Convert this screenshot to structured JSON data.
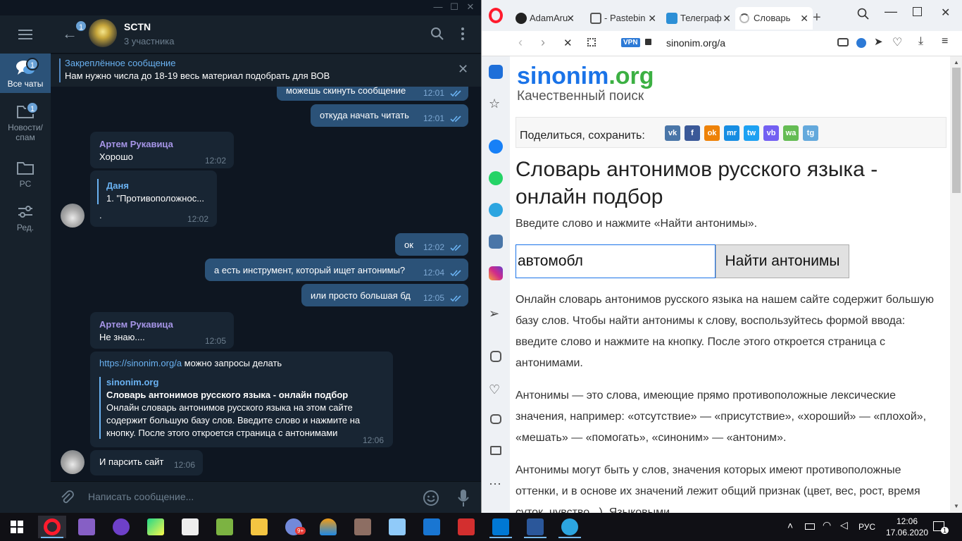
{
  "telegram": {
    "folders": [
      {
        "label": "Все чаты",
        "badge": "1"
      },
      {
        "label": "Новости/\nспам",
        "badge": "1"
      },
      {
        "label": "PC",
        "badge": ""
      },
      {
        "label": "Ред.",
        "badge": ""
      }
    ],
    "header": {
      "back_badge": "1",
      "title": "SCTN",
      "subtitle": "3 участника"
    },
    "pinned": {
      "title": "Закреплённое сообщение",
      "text": "Нам нужно числа до 18-19 весь материал подобрать для ВОВ"
    },
    "messages": [
      {
        "text": "можешь скинуть сообщение",
        "time": "12:01"
      },
      {
        "text": "откуда начать читать",
        "time": "12:01"
      },
      {
        "sender": "Артем Рукавица",
        "text": "Хорошо",
        "time": "12:02"
      },
      {
        "reply_name": "Даня",
        "reply_text": "1. \"Противоположнос...",
        "text": ".",
        "time": "12:02"
      },
      {
        "text": "ок",
        "time": "12:02"
      },
      {
        "text": "а есть инструмент, который ищет антонимы?",
        "time": "12:04"
      },
      {
        "text": "или просто большая бд",
        "time": "12:05"
      },
      {
        "sender": "Артем Рукавица",
        "text": "Не знаю....",
        "time": "12:05"
      },
      {
        "link": "https://sinonim.org/a",
        "text_after": " можно запросы делать",
        "preview_site": "sinonim.org",
        "preview_title": "Словарь антонимов русского языка - онлайн подбор",
        "preview_desc": "Онлайн словарь антонимов русского языка на этом сайте содержит большую базу слов. Введите слово и нажмите на кнопку. После этого откроется страница с антонимами",
        "time": "12:06"
      },
      {
        "text": "И парсить сайт",
        "time": "12:06"
      }
    ],
    "compose_placeholder": "Написать сообщение..."
  },
  "opera": {
    "tabs": [
      {
        "label": "AdamAru"
      },
      {
        "label": "- Pastebin"
      },
      {
        "label": "Телеграф"
      },
      {
        "label": "Словарь"
      }
    ],
    "address": {
      "vpn": "VPN",
      "url": "sinonim.org/a"
    },
    "page": {
      "logo_main": "sinonim",
      "logo_tld": ".org",
      "tagline": "Качественный поиск",
      "share_label": "Поделиться, сохранить:",
      "share_icons": [
        "vk",
        "f",
        "ok",
        "mr",
        "tw",
        "vb",
        "wa",
        "tg"
      ],
      "heading": "Словарь антонимов русского языка - онлайн подбор",
      "instruction": "Введите слово и нажмите «Найти антонимы».",
      "search_value": "автомобл",
      "search_button": "Найти антонимы",
      "para1": "Онлайн словарь антонимов русского языка на нашем сайте содержит большую базу слов. Чтобы найти антонимы к слову, воспользуйтесь формой ввода: введите слово и нажмите на кнопку. После этого откроется страница с антонимами.",
      "para2": "Антонимы — это слова, имеющие прямо противоположные лексические значения, например: «отсутствие» — «присутствие», «хороший» — «плохой», «мешать» — «помогать», «синоним» — «антоним».",
      "para3": "Антонимы могут быть у слов, значения которых имеют противоположные оттенки, и в основе их значений лежит общий признак (цвет, вес, рост, время суток, чувство...). Языковыми"
    }
  },
  "taskbar": {
    "language": "РУС",
    "time": "12:06",
    "date": "17.06.2020",
    "notification_badge": "1",
    "discord_badge": "9+"
  },
  "colors": {
    "telegram_bg": "#0e1621",
    "telegram_panel": "#17212b",
    "outgoing_bubble": "#2b5278",
    "incoming_bubble": "#182533",
    "opera_red": "#ff1b2d",
    "sinonim_blue": "#1a73e8"
  }
}
